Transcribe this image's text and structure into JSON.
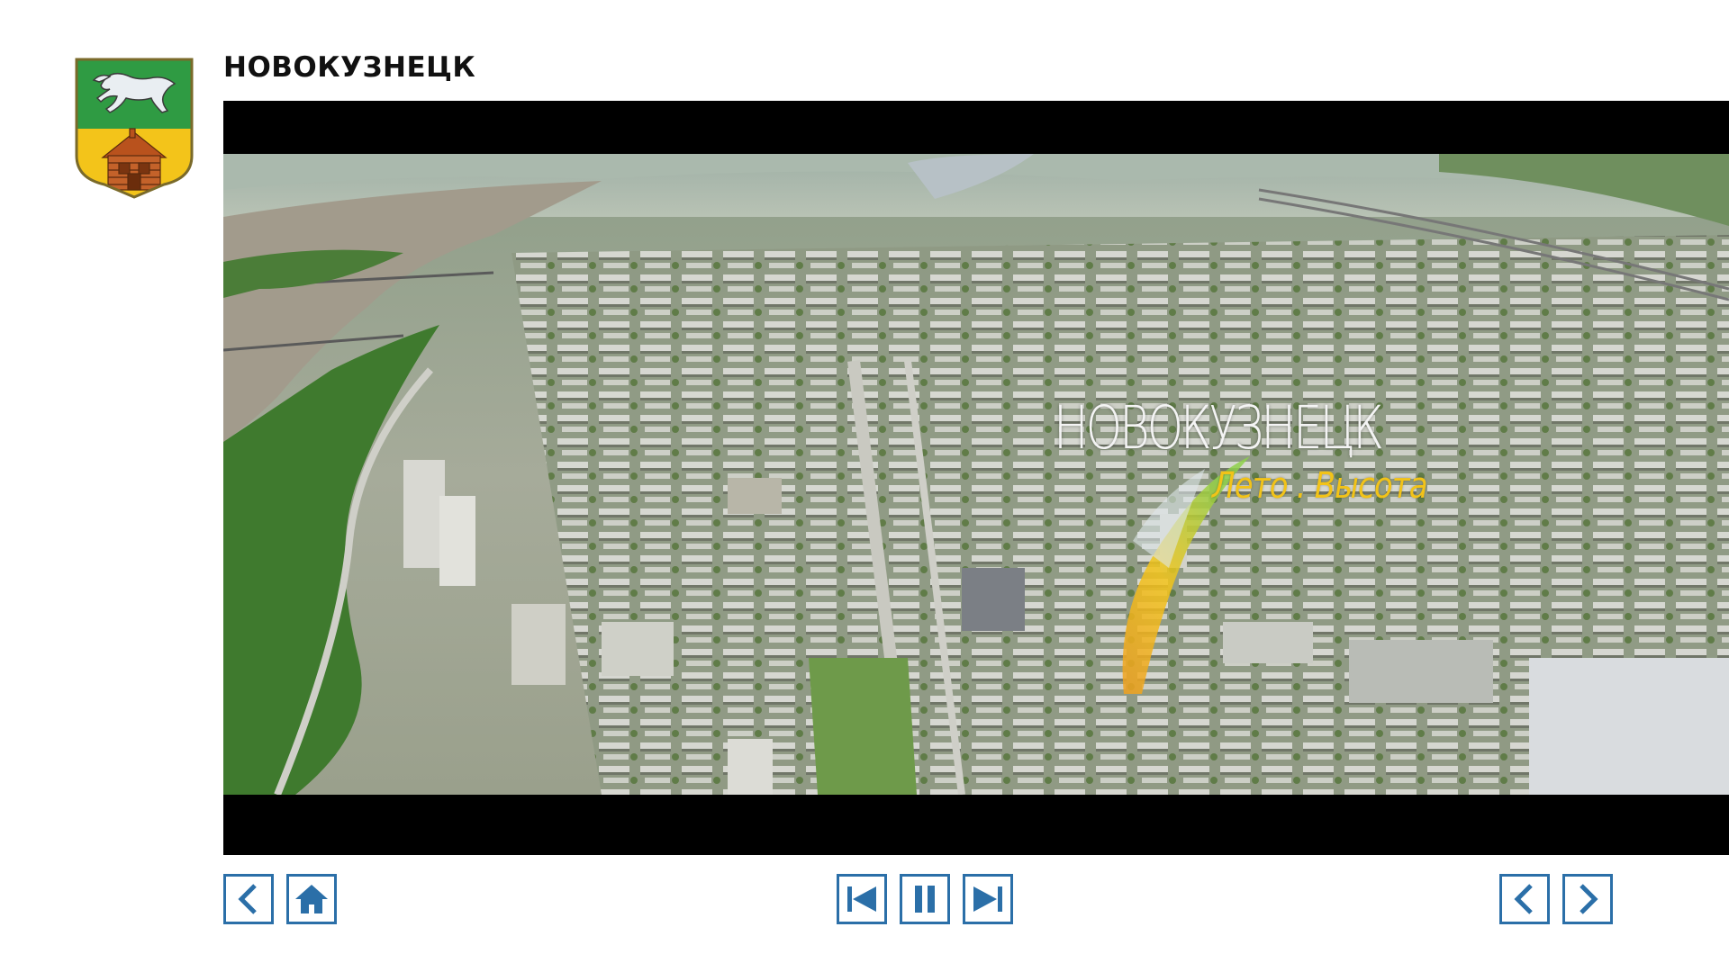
{
  "header": {
    "city_title": "НОВОКУЗНЕЦК",
    "coat_of_arms_icon": "novokuznetsk-coat-of-arms-icon"
  },
  "video": {
    "overlay_title": "НОВОКУЗНЕЦК",
    "overlay_subtitle": "Лето . Высота"
  },
  "controls": {
    "left_group": [
      {
        "icon": "chevron-left-icon",
        "action": "back"
      },
      {
        "icon": "home-icon",
        "action": "home"
      }
    ],
    "center_group": [
      {
        "icon": "skip-previous-icon",
        "action": "previous"
      },
      {
        "icon": "pause-icon",
        "action": "pause"
      },
      {
        "icon": "skip-next-icon",
        "action": "next"
      }
    ],
    "right_group": [
      {
        "icon": "chevron-left-icon",
        "action": "previous-page"
      },
      {
        "icon": "chevron-right-icon",
        "action": "next-page"
      }
    ]
  },
  "colors": {
    "accent": "#2b6fa8",
    "title_text": "#111111",
    "subtitle_yellow": "#f2c318"
  }
}
